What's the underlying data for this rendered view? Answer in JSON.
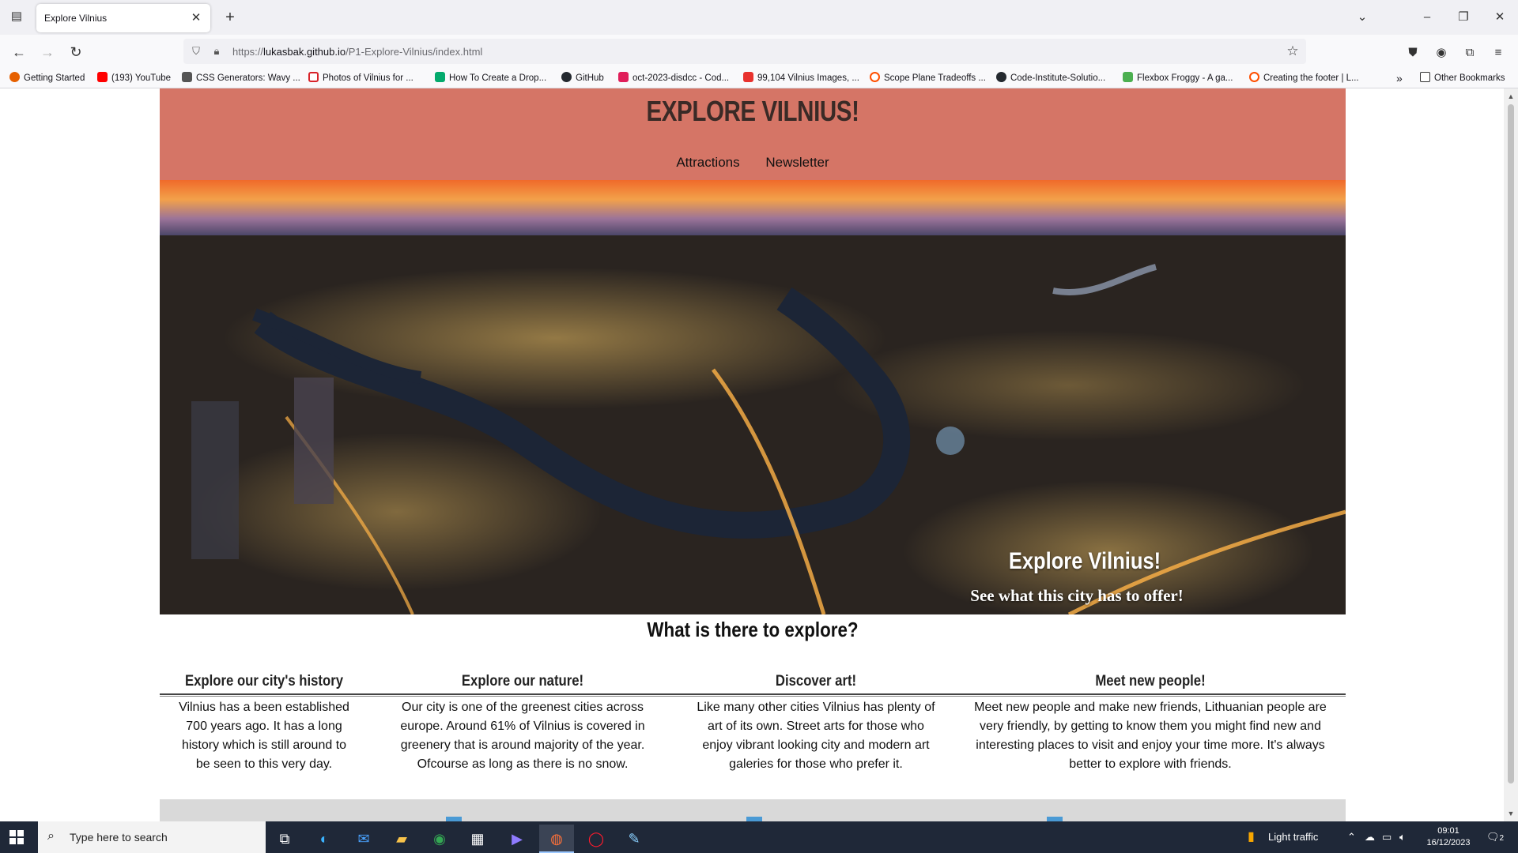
{
  "browser": {
    "tab_title": "Explore Vilnius",
    "url_domain": "lukasbak.github.io",
    "url_path": "/P1-Explore-Vilnius/index.html",
    "url_prefix": "https://",
    "bookmarks": [
      {
        "label": "Getting Started",
        "color": "#e66000"
      },
      {
        "label": "(193) YouTube",
        "color": "#ff0000"
      },
      {
        "label": "CSS Generators: Wavy ...",
        "color": "#555555"
      },
      {
        "label": "Photos of Vilnius for ...",
        "color": "#d8232a"
      },
      {
        "label": "How To Create a Drop...",
        "color": "#04aa6d"
      },
      {
        "label": "GitHub",
        "color": "#24292f"
      },
      {
        "label": "oct-2023-disdcc - Cod...",
        "color": "#e01e5a"
      },
      {
        "label": "99,104 Vilnius Images, ...",
        "color": "#e8322e"
      },
      {
        "label": "Scope Plane Tradeoffs ...",
        "color": "#ff4f00"
      },
      {
        "label": "Code-Institute-Solutio...",
        "color": "#24292f"
      },
      {
        "label": "Flexbox Froggy - A ga...",
        "color": "#4caf50"
      },
      {
        "label": "Creating the footer | L...",
        "color": "#ff4f00"
      }
    ],
    "other_bookmarks": "Other Bookmarks"
  },
  "site": {
    "title": "EXPLORE VILNIUS!",
    "nav": [
      "Attractions",
      "Newsletter"
    ],
    "hero": {
      "caption_title": "Explore Vilnius!",
      "caption_sub": "See what this city has to offer!"
    },
    "explore_heading": "What is there to explore?",
    "columns": [
      {
        "title": "Explore our city's history",
        "text": "Vilnius has a been established 700 years ago. It has a long history which is still around to be seen to this very day."
      },
      {
        "title": "Explore our nature!",
        "text": "Our city is one of the greenest cities across europe. Around 61% of Vilnius is covered in greenery that is around majority of the year. Ofcourse as long as there is no snow."
      },
      {
        "title": "Discover art!",
        "text": "Like many other cities Vilnius has plenty of art of its own. Street arts for those who enjoy vibrant looking city and modern art galeries for those who prefer it."
      },
      {
        "title": "Meet new people!",
        "text": "Meet new people and make new friends, Lithuanian people are very friendly, by getting to know them you might find new and interesting places to visit and enjoy your time more. It's always better to explore with friends."
      }
    ]
  },
  "taskbar": {
    "search_placeholder": "Type here to search",
    "weather": "Light traffic",
    "time": "09:01",
    "date": "16/12/2023",
    "notifications": "2"
  }
}
